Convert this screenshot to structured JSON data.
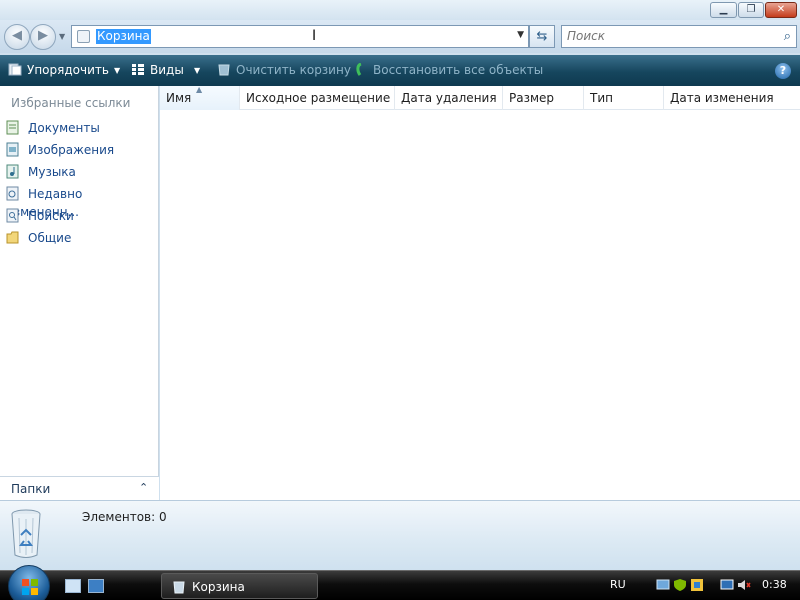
{
  "window": {
    "controls": [
      "minimize",
      "maximize",
      "close"
    ]
  },
  "navigation": {
    "address_value": "Корзина",
    "search_placeholder": "Поиск"
  },
  "toolbar": {
    "organize_label": "Упорядочить",
    "views_label": "Виды",
    "empty_bin_label": "Очистить корзину",
    "restore_all_label": "Восстановить все объекты"
  },
  "sidebar": {
    "title": "Избранные ссылки",
    "items": [
      {
        "label": "Документы",
        "icon": "documents-icon"
      },
      {
        "label": "Изображения",
        "icon": "pictures-icon"
      },
      {
        "label": "Музыка",
        "icon": "music-icon"
      },
      {
        "label": "Недавно измененн...",
        "icon": "recent-icon"
      },
      {
        "label": "Поиски",
        "icon": "searches-icon"
      },
      {
        "label": "Общие",
        "icon": "public-folder-icon"
      }
    ],
    "folders_label": "Папки"
  },
  "file_list": {
    "columns": [
      "Имя",
      "Исходное размещение",
      "Дата удаления",
      "Размер",
      "Тип",
      "Дата изменения"
    ],
    "sorted_column": "Имя",
    "rows": []
  },
  "details": {
    "count_text": "Элементов: 0"
  },
  "taskbar": {
    "task_label": "Корзина",
    "language": "RU",
    "clock": "0:38"
  },
  "colors": {
    "accent": "#3399ff",
    "command_bar": "#16465e",
    "link": "#1a4a8c"
  }
}
